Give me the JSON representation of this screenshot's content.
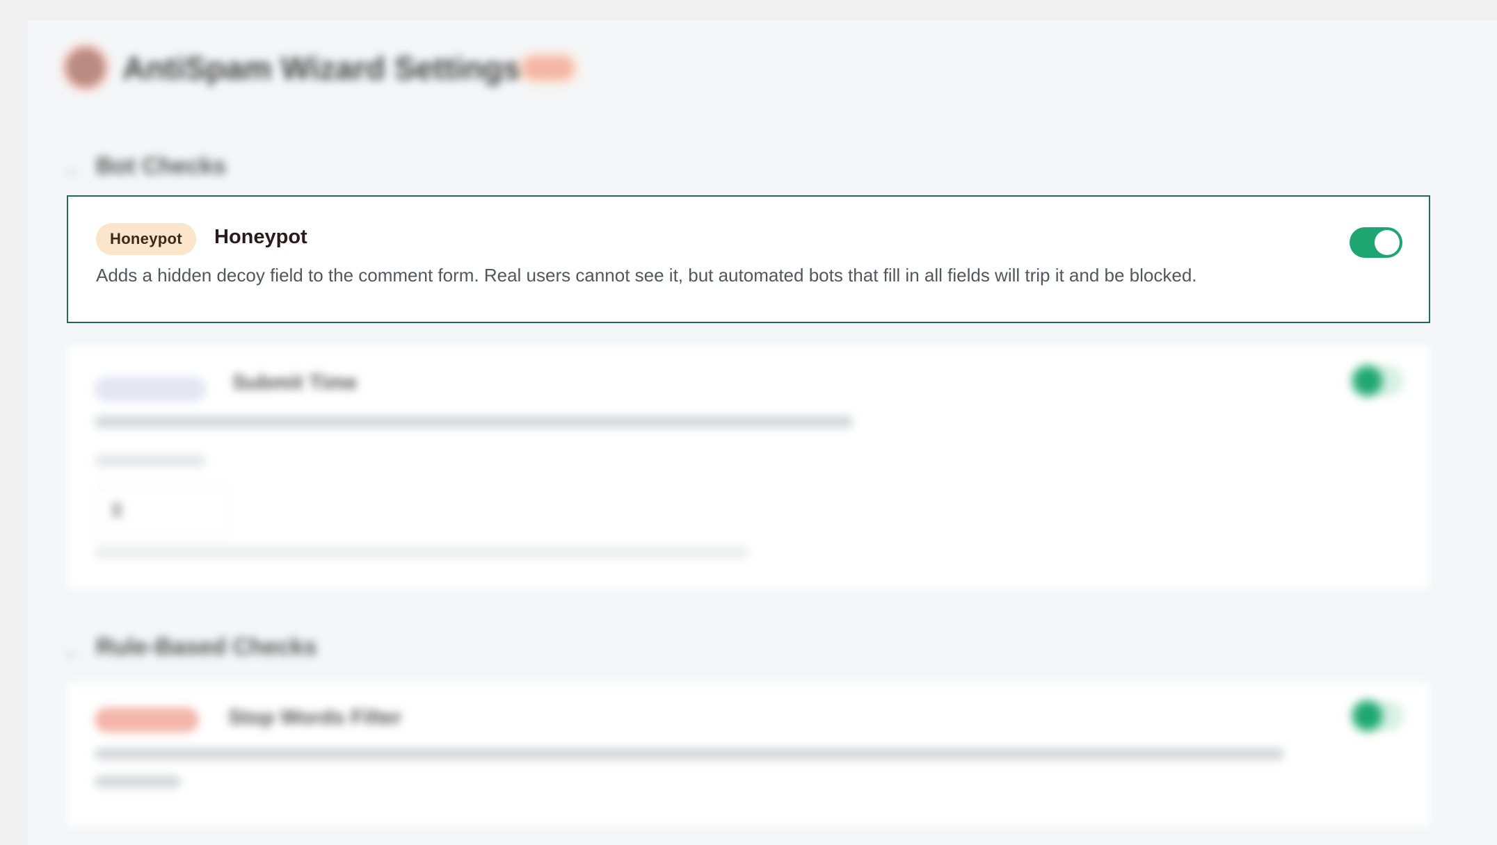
{
  "header": {
    "title": "AntiSpam Wizard Settings",
    "badge_color": "#f4b7a6"
  },
  "sections": [
    {
      "title": "Bot Checks",
      "cards": [
        {
          "pill": "Honeypot",
          "title": "Honeypot",
          "description": "Adds a hidden decoy field to the comment form. Real users cannot see it, but automated bots that fill in all fields will trip it and be blocked.",
          "enabled": true,
          "accent": "#1ea672"
        },
        {
          "title": "Submit Time",
          "description": "Measures how long the user took to submit the form. Bots typically submit forms instantly.",
          "field_label": "Min seconds",
          "field_value": "3",
          "field_help": "Flag a comment if the author took less than this many seconds to post the comment.",
          "enabled": true
        }
      ]
    },
    {
      "title": "Rule-Based Checks",
      "cards": [
        {
          "title": "Stop Words Filter",
          "description": "Blocks comments containing words from your blacklist. Supports exact match and wildcard patterns. Configure the list on the Stop Words tab.",
          "enabled": true
        }
      ]
    }
  ]
}
